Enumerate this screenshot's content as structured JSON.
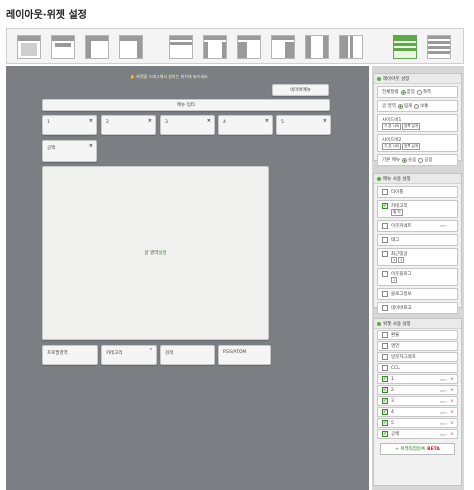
{
  "title": "레이아웃·위젯 설정",
  "layout_buttons": [
    {
      "name": "layout-1"
    },
    {
      "name": "layout-2"
    },
    {
      "name": "layout-3"
    },
    {
      "name": "layout-4"
    },
    {
      "name": "layout-5"
    },
    {
      "name": "layout-6"
    },
    {
      "name": "layout-7"
    },
    {
      "name": "layout-8"
    },
    {
      "name": "layout-9"
    },
    {
      "name": "layout-10"
    },
    {
      "name": "layout-11",
      "selected": true
    },
    {
      "name": "layout-12"
    }
  ],
  "canvas": {
    "hint": "위젯을 드래그해서 원하는 위치에 놓으세요.",
    "hint_icon": "drag-hand-icon",
    "top_widget": "네이버메뉴",
    "menu_bar": "메뉴 텀타",
    "row_boxes": [
      "1",
      "2",
      "3",
      "4",
      "5"
    ],
    "blank_box": "공백",
    "content_area": "글 영역",
    "content_area_link": "설정",
    "bottom_boxes": [
      "프로필영역",
      "카테고리",
      "검색",
      "RSS/ATOM"
    ]
  },
  "layout_panel": {
    "header": "레이아웃 설정",
    "rows": [
      {
        "label": "전체정렬",
        "options": [
          "중앙",
          "좌측"
        ],
        "selected": 0
      },
      {
        "label": "글 영역",
        "options": [
          "넓게",
          "보통"
        ],
        "selected": 0
      },
      {
        "label": "사이드바1",
        "selects": [
          "기 본 너비",
          "왼쪽 날개"
        ]
      },
      {
        "label": "사이드바2",
        "selects": [
          "기 본 너비",
          "왼쪽 날개"
        ]
      },
      {
        "label": "기본 메뉴",
        "options": [
          "숫음",
          "공용"
        ],
        "selected": 0
      }
    ]
  },
  "menu_panel": {
    "header": "메뉴 사용 설정",
    "items": [
      {
        "label": "타이틀",
        "checked": false
      },
      {
        "label": "카테고리",
        "checked": true,
        "select": "펼 치"
      },
      {
        "label": "이웃커넥트",
        "checked": false,
        "edit": "EDIT"
      },
      {
        "label": "태그",
        "checked": false
      },
      {
        "label": "최근댓글",
        "checked": false,
        "selects": [
          "1",
          "2"
        ]
      },
      {
        "label": "이웃블로그",
        "checked": false,
        "selects": [
          "1"
        ]
      },
      {
        "label": "블로그정보",
        "checked": false
      },
      {
        "label": "네이버로고",
        "checked": false
      }
    ]
  },
  "widget_panel": {
    "header": "위젯 사용 설정",
    "items": [
      {
        "label": "환율",
        "checked": false
      },
      {
        "label": "명언",
        "checked": false
      },
      {
        "label": "방문자그래프",
        "checked": false
      },
      {
        "label": "CCL",
        "checked": false
      },
      {
        "label": "1",
        "checked": true,
        "edit": "EDIT"
      },
      {
        "label": "2",
        "checked": true,
        "edit": "EDIT"
      },
      {
        "label": "3",
        "checked": true,
        "edit": "EDIT"
      },
      {
        "label": "4",
        "checked": true,
        "edit": "EDIT"
      },
      {
        "label": "5",
        "checked": true,
        "edit": "EDIT"
      },
      {
        "label": "공백",
        "checked": true,
        "edit": "EDIT"
      }
    ],
    "register_button": "위젯직접등록",
    "register_badge": "BETA"
  },
  "colors": {
    "accent": "#5fa84a",
    "canvas": "#7b7e83",
    "hint": "#f6f8c0"
  }
}
